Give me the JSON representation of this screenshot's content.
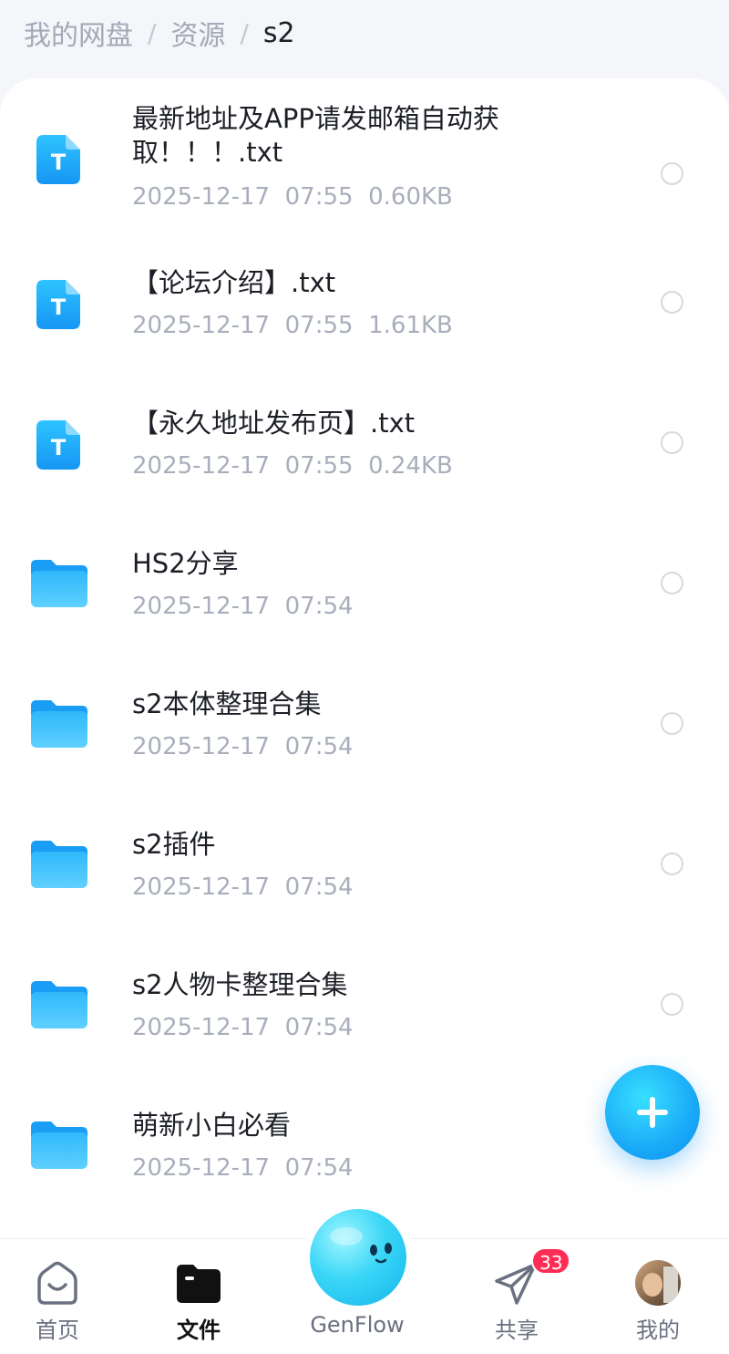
{
  "breadcrumb": {
    "root": "我的网盘",
    "sep1": "/",
    "middle": "资源",
    "sep2": "/",
    "current": "s2"
  },
  "files": [
    {
      "type": "txt",
      "icon": "text-file-icon",
      "name": "最新地址及APP请发邮箱自动获取！！！.txt",
      "date": "2025-12-17  07:55",
      "size": "0.60KB"
    },
    {
      "type": "txt",
      "icon": "text-file-icon",
      "name": "【论坛介绍】.txt",
      "date": "2025-12-17  07:55",
      "size": "1.61KB"
    },
    {
      "type": "txt",
      "icon": "text-file-icon",
      "name": "【永久地址发布页】.txt",
      "date": "2025-12-17  07:55",
      "size": "0.24KB"
    },
    {
      "type": "folder",
      "icon": "folder-icon",
      "name": "HS2分享",
      "date": "2025-12-17  07:54",
      "size": ""
    },
    {
      "type": "folder",
      "icon": "folder-icon",
      "name": "s2本体整理合集",
      "date": "2025-12-17  07:54",
      "size": ""
    },
    {
      "type": "folder",
      "icon": "folder-icon",
      "name": "s2插件",
      "date": "2025-12-17  07:54",
      "size": ""
    },
    {
      "type": "folder",
      "icon": "folder-icon",
      "name": "s2人物卡整理合集",
      "date": "2025-12-17  07:54",
      "size": ""
    },
    {
      "type": "folder",
      "icon": "folder-icon",
      "name": "萌新小白必看",
      "date": "2025-12-17  07:54",
      "size": ""
    }
  ],
  "fab": {
    "icon": "plus-icon"
  },
  "tabbar": {
    "home": {
      "label": "首页",
      "icon": "home-icon"
    },
    "files": {
      "label": "文件",
      "icon": "files-icon",
      "active": true
    },
    "genflow": {
      "label": "GenFlow",
      "icon": "genflow-orb-icon"
    },
    "share": {
      "label": "共享",
      "icon": "send-icon",
      "badge": "33"
    },
    "me": {
      "label": "我的",
      "icon": "avatar"
    }
  },
  "colors": {
    "accent": "#1aa9f7",
    "badge": "#ff2d55",
    "muted_text": "#a8aebb"
  }
}
